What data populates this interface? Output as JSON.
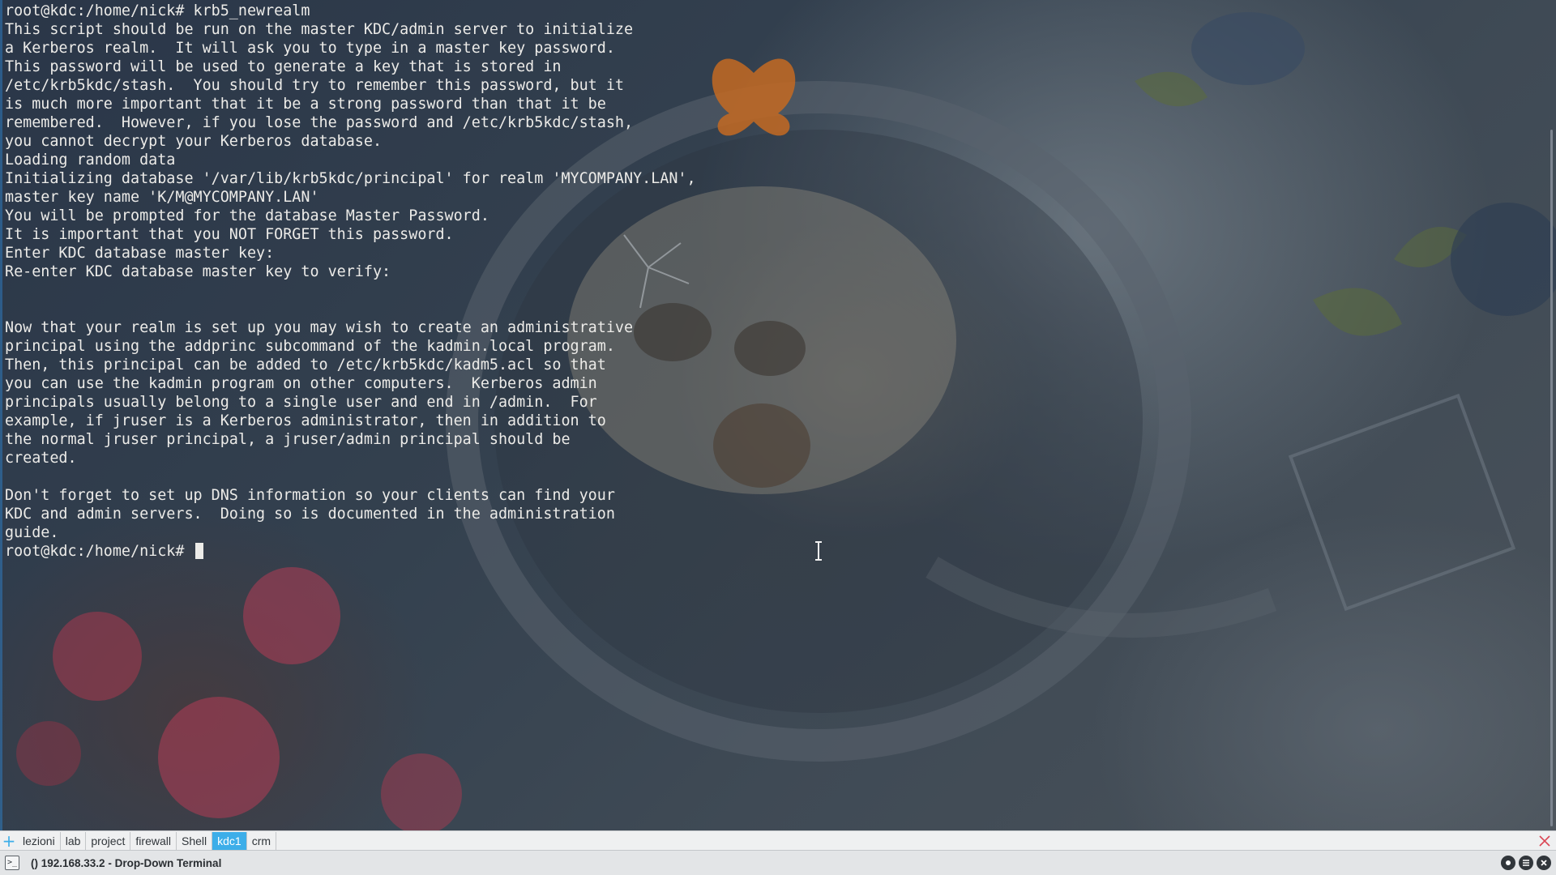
{
  "terminal": {
    "lines": [
      "root@kdc:/home/nick# krb5_newrealm",
      "This script should be run on the master KDC/admin server to initialize",
      "a Kerberos realm.  It will ask you to type in a master key password.",
      "This password will be used to generate a key that is stored in",
      "/etc/krb5kdc/stash.  You should try to remember this password, but it",
      "is much more important that it be a strong password than that it be",
      "remembered.  However, if you lose the password and /etc/krb5kdc/stash,",
      "you cannot decrypt your Kerberos database.",
      "Loading random data",
      "Initializing database '/var/lib/krb5kdc/principal' for realm 'MYCOMPANY.LAN',",
      "master key name 'K/M@MYCOMPANY.LAN'",
      "You will be prompted for the database Master Password.",
      "It is important that you NOT FORGET this password.",
      "Enter KDC database master key:",
      "Re-enter KDC database master key to verify:",
      "",
      "",
      "Now that your realm is set up you may wish to create an administrative",
      "principal using the addprinc subcommand of the kadmin.local program.",
      "Then, this principal can be added to /etc/krb5kdc/kadm5.acl so that",
      "you can use the kadmin program on other computers.  Kerberos admin",
      "principals usually belong to a single user and end in /admin.  For",
      "example, if jruser is a Kerberos administrator, then in addition to",
      "the normal jruser principal, a jruser/admin principal should be",
      "created.",
      "",
      "Don't forget to set up DNS information so your clients can find your",
      "KDC and admin servers.  Doing so is documented in the administration",
      "guide."
    ],
    "prompt": "root@kdc:/home/nick# "
  },
  "tabs": [
    {
      "label": "lezioni",
      "active": false
    },
    {
      "label": "lab",
      "active": false
    },
    {
      "label": "project",
      "active": false
    },
    {
      "label": "firewall",
      "active": false
    },
    {
      "label": "Shell",
      "active": false
    },
    {
      "label": "kdc1",
      "active": true
    },
    {
      "label": "crm",
      "active": false
    }
  ],
  "status_bar": {
    "title": "() 192.168.33.2 - Drop-Down Terminal",
    "icons": [
      "terminal-icon",
      "info-icon",
      "menu-icon",
      "close-icon"
    ]
  },
  "colors": {
    "accent": "#3daee9",
    "terminal_text": "#ecebe8",
    "tab_bar_bg": "#eff0f1",
    "close_tab_red": "#da4453"
  }
}
